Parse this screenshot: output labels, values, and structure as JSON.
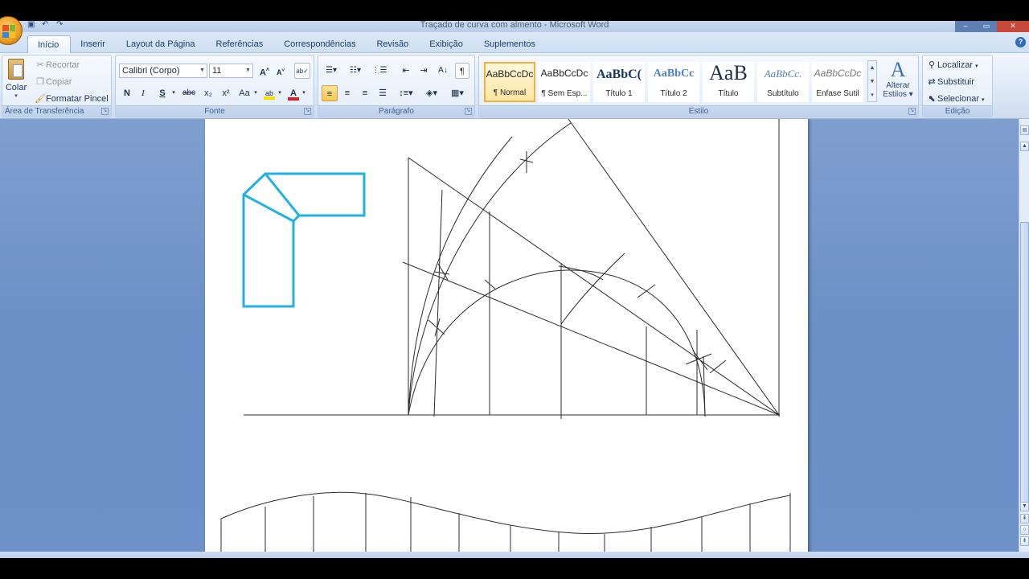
{
  "window": {
    "title": "Traçado de curva com almento - Microsoft Word"
  },
  "tabs": [
    {
      "label": "Início",
      "active": true
    },
    {
      "label": "Inserir"
    },
    {
      "label": "Layout da Página"
    },
    {
      "label": "Referências"
    },
    {
      "label": "Correspondências"
    },
    {
      "label": "Revisão"
    },
    {
      "label": "Exibição"
    },
    {
      "label": "Suplementos"
    }
  ],
  "clipboard": {
    "paste_label": "Colar",
    "cut_label": "Recortar",
    "copy_label": "Copiar",
    "format_painter_label": "Formatar Pincel",
    "group_label": "Área de Transferência"
  },
  "font": {
    "family_value": "Calibri (Corpo)",
    "size_value": "11",
    "bold": "N",
    "italic": "I",
    "underline": "S",
    "strike": "abc",
    "subscript": "x₂",
    "superscript": "x²",
    "change_case": "Aa",
    "group_label": "Fonte"
  },
  "paragraph": {
    "group_label": "Parágrafo"
  },
  "styles": {
    "group_label": "Estilo",
    "items": [
      {
        "sample": "AaBbCcDc",
        "name": "¶ Normal",
        "selected": true
      },
      {
        "sample": "AaBbCcDc",
        "name": "¶ Sem Esp..."
      },
      {
        "sample": "AaBbC(",
        "name": "Título 1"
      },
      {
        "sample": "AaBbCc",
        "name": "Título 2"
      },
      {
        "sample": "AaB",
        "name": "Título"
      },
      {
        "sample": "AaBbCc.",
        "name": "Subtítulo"
      },
      {
        "sample": "AaBbCcDc",
        "name": "Ênfase Sutil"
      }
    ],
    "change_styles_label_1": "Alterar",
    "change_styles_label_2": "Estilos"
  },
  "editing": {
    "group_label": "Edição",
    "find_label": "Localizar",
    "replace_label": "Substituir",
    "select_label": "Selecionar"
  },
  "colors": {
    "shape_outline": "#22b2e0",
    "pen": "#2b2b2b",
    "highlight": "#f5e000",
    "font_color": "#e02020"
  }
}
